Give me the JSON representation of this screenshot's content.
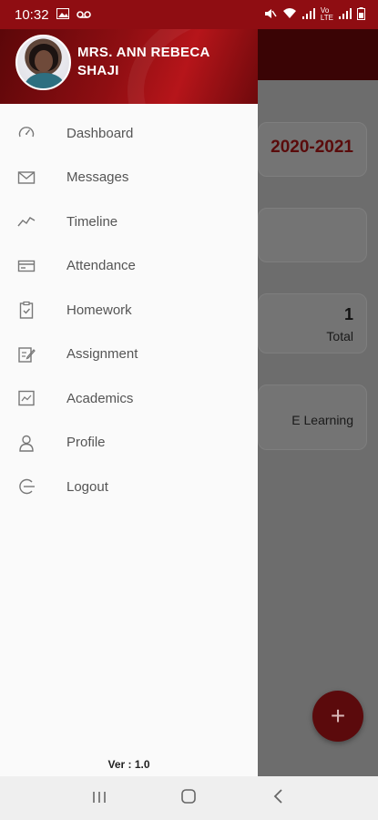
{
  "status_bar": {
    "time": "10:32",
    "left_icons": [
      "image-icon",
      "voicemail-icon"
    ],
    "right_icons": [
      "mute-icon",
      "wifi-icon",
      "signal-icon",
      "volte-icon",
      "signal-icon",
      "battery-icon"
    ]
  },
  "drawer": {
    "user_name": "MRS. ANN REBECA SHAJI",
    "menu": [
      {
        "label": "Dashboard",
        "icon": "speedometer-icon"
      },
      {
        "label": "Messages",
        "icon": "mail-icon"
      },
      {
        "label": "Timeline",
        "icon": "trend-line-icon"
      },
      {
        "label": "Attendance",
        "icon": "card-icon"
      },
      {
        "label": "Homework",
        "icon": "clipboard-icon"
      },
      {
        "label": "Assignment",
        "icon": "edit-document-icon"
      },
      {
        "label": "Academics",
        "icon": "chart-frame-icon"
      },
      {
        "label": "Profile",
        "icon": "person-icon"
      },
      {
        "label": "Logout",
        "icon": "logout-icon"
      }
    ],
    "version": "Ver : 1.0"
  },
  "background": {
    "year": "2020-2021",
    "count": "1",
    "count_label": "Total",
    "elearning": "E Learning",
    "fab": "+"
  },
  "navbar": {
    "recent": "|||",
    "home": "○",
    "back": "‹"
  },
  "colors": {
    "brand": "#8f0d12",
    "drawer_bg": "#fafafa",
    "scrim": "#6d6d6d"
  }
}
